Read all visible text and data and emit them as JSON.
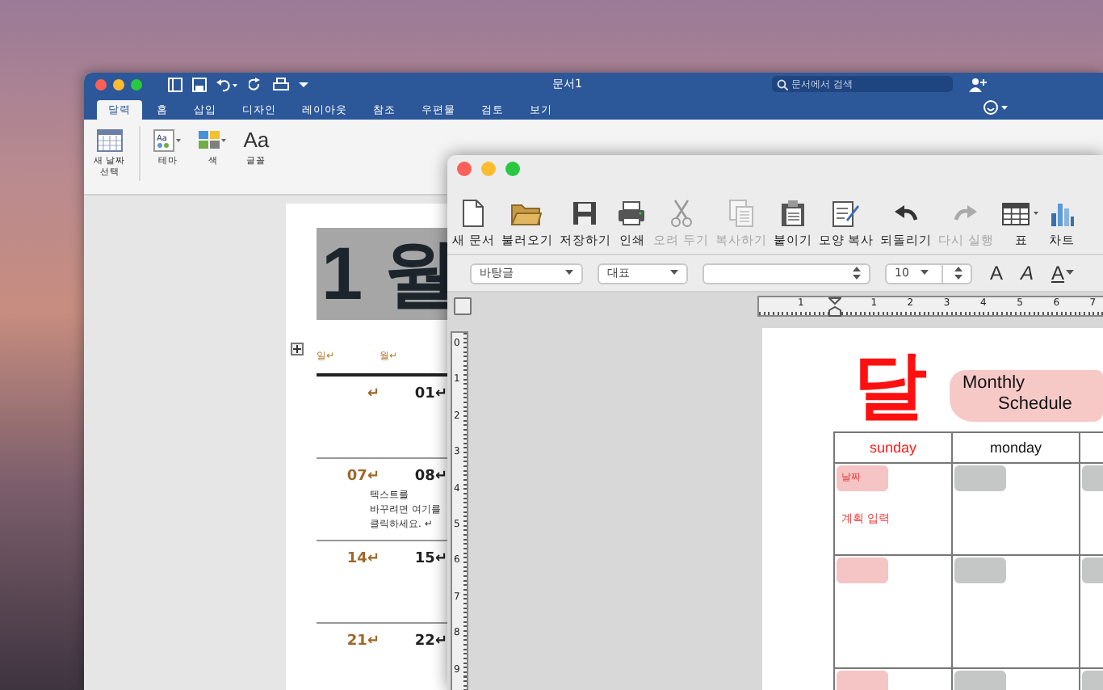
{
  "word_window": {
    "title": "문서1",
    "search": {
      "placeholder": "문서에서 검색"
    },
    "tabs": [
      {
        "label": "달력",
        "selected": true
      },
      {
        "label": "홈",
        "selected": false
      },
      {
        "label": "삽입",
        "selected": false
      },
      {
        "label": "디자인",
        "selected": false
      },
      {
        "label": "레이아웃",
        "selected": false
      },
      {
        "label": "참조",
        "selected": false
      },
      {
        "label": "우편물",
        "selected": false
      },
      {
        "label": "검토",
        "selected": false
      },
      {
        "label": "보기",
        "selected": false
      }
    ],
    "ribbon": [
      {
        "label": "새 날짜\n선택",
        "kind": "calendar"
      },
      {
        "label": "테마",
        "kind": "theme",
        "glyph": "Aa"
      },
      {
        "label": "색",
        "kind": "colors"
      },
      {
        "label": "글꼴",
        "kind": "fonts",
        "glyph": "Aa"
      }
    ],
    "page": {
      "heading": "1 월",
      "day_labels": [
        "일↵",
        "월↵"
      ],
      "weeks": [
        {
          "dates": [
            "↵",
            "01↵"
          ]
        },
        {
          "dates": [
            "07↵",
            "08↵"
          ],
          "note": "텍스트를\n바꾸려면 여기를\n클릭하세요. ↵"
        },
        {
          "dates": [
            "14↵",
            "15↵"
          ]
        },
        {
          "dates": [
            "21↵",
            "22↵"
          ]
        }
      ]
    }
  },
  "hwp_window": {
    "toolbar": [
      {
        "label": "새 문서",
        "kind": "new",
        "disabled": false
      },
      {
        "label": "불러오기",
        "kind": "open",
        "disabled": false
      },
      {
        "label": "저장하기",
        "kind": "save",
        "disabled": false
      },
      {
        "label": "인쇄",
        "kind": "print",
        "disabled": false
      },
      {
        "label": "오려 두기",
        "kind": "cut",
        "disabled": true
      },
      {
        "label": "복사하기",
        "kind": "copy",
        "disabled": true
      },
      {
        "label": "붙이기",
        "kind": "paste",
        "disabled": false
      },
      {
        "label": "모양 복사",
        "kind": "format",
        "disabled": false
      },
      {
        "label": "되돌리기",
        "kind": "undo",
        "disabled": false
      },
      {
        "label": "다시 실행",
        "kind": "redo",
        "disabled": true
      },
      {
        "label": "표",
        "kind": "table",
        "disabled": false
      },
      {
        "label": "차트",
        "kind": "chart",
        "disabled": false
      }
    ],
    "format_bar": {
      "style": "바탕글",
      "font": "대표",
      "size": "10",
      "text_buttons": [
        {
          "label": "A",
          "kind": "bold"
        },
        {
          "label": "A",
          "kind": "italic"
        },
        {
          "label": "A",
          "kind": "underline"
        }
      ]
    },
    "ruler": {
      "labels": [
        "1",
        "1",
        "2",
        "3",
        "4",
        "5",
        "6",
        "7"
      ]
    },
    "vertical_ruler": {
      "labels": [
        "0",
        "1",
        "2",
        "3",
        "4",
        "5",
        "6",
        "7",
        "8",
        "9"
      ]
    },
    "page": {
      "big_char": "달",
      "title_lines": [
        "Monthly",
        "Schedule"
      ],
      "columns": [
        {
          "label": "sunday",
          "color": "#ff1a1a"
        },
        {
          "label": "monday",
          "color": "#111111"
        }
      ],
      "rows": [
        {
          "cells": [
            {
              "color": "#f5c4c4",
              "tag": "날짜",
              "text": "계획 입력"
            },
            {
              "color": "#c4c7c6"
            },
            {
              "color": "#c4c7c6"
            }
          ]
        },
        {
          "cells": [
            {
              "color": "#f5c4c4"
            },
            {
              "color": "#c4c7c6"
            },
            {
              "color": "#c4c7c6"
            }
          ]
        },
        {
          "cells": [
            {
              "color": "#f5c4c4"
            },
            {
              "color": "#c4c7c6"
            },
            {
              "color": "#c4c7c6"
            }
          ]
        }
      ]
    }
  }
}
